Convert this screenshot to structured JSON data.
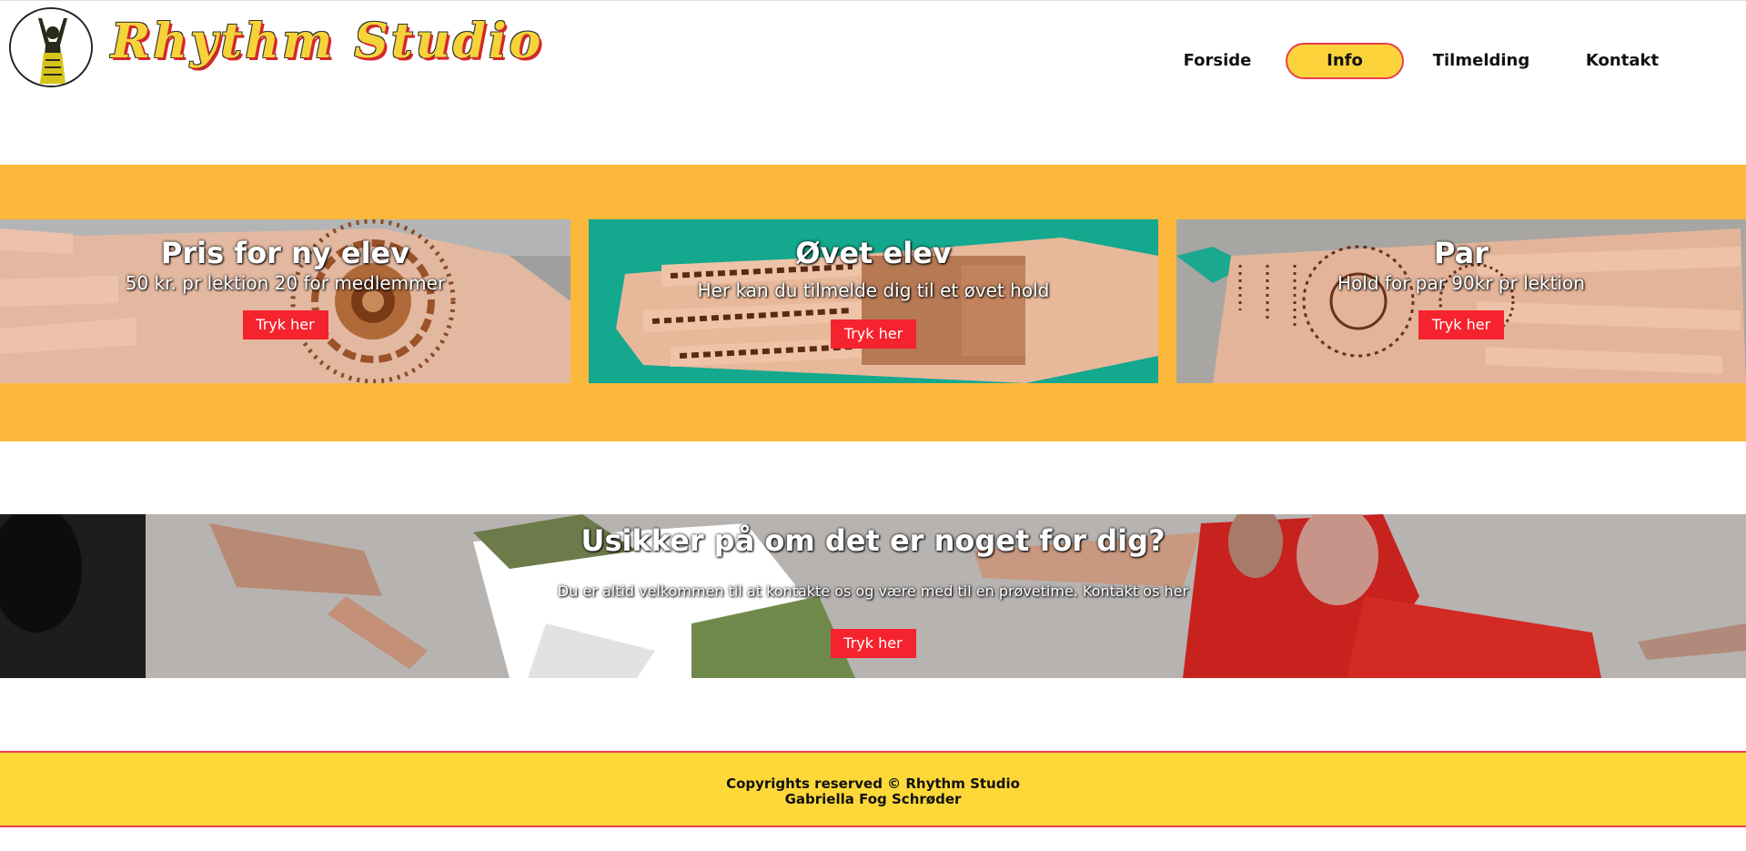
{
  "brand": {
    "logo_text": "Rhythm Studio",
    "logo_icon": "dancer-silhouette-icon",
    "colors": {
      "yellow": "#fdd33c",
      "red": "#f5232e",
      "orange": "#fcb83a"
    }
  },
  "nav": {
    "items": [
      {
        "label": "Forside",
        "active": false
      },
      {
        "label": "Info",
        "active": true
      },
      {
        "label": "Tilmelding",
        "active": false
      },
      {
        "label": "Kontakt",
        "active": false
      }
    ]
  },
  "cards": [
    {
      "title": "Pris for ny elev",
      "subtitle": "50 kr. pr lektion 20 for medlemmer",
      "button": "Tryk her"
    },
    {
      "title": "Øvet elev",
      "subtitle": "Her kan du tilmelde dig til et øvet hold",
      "button": "Tryk her"
    },
    {
      "title": "Par",
      "subtitle": "Hold for par 90kr pr lektion",
      "button": "Tryk her"
    }
  ],
  "banner": {
    "title": "Usikker på om det er noget for dig?",
    "text": "Du er altid velkommen til at kontakte os og være med til en prøvetime. Kontakt os her",
    "button": "Tryk her"
  },
  "footer": {
    "line1": "Copyrights reserved © Rhythm Studio",
    "line2": "Gabriella Fog Schrøder"
  }
}
